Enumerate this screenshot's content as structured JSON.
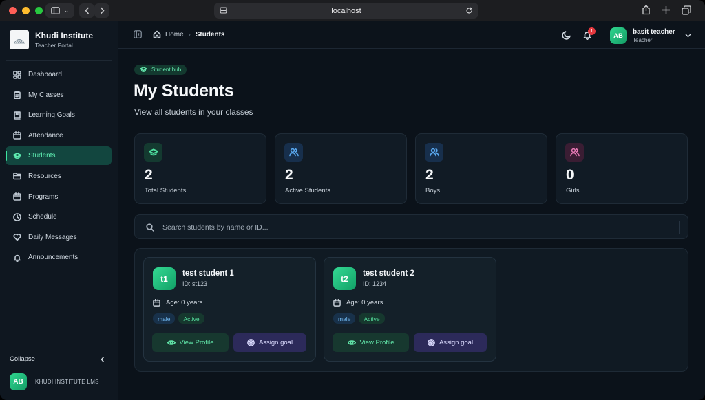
{
  "browser": {
    "url": "localhost",
    "traffic_colors": [
      "#ff5f57",
      "#febc2e",
      "#28c840"
    ]
  },
  "sidebar": {
    "brand_name": "Khudi Institute",
    "brand_sub": "Teacher Portal",
    "items": [
      {
        "label": "Dashboard",
        "icon": "dashboard-icon"
      },
      {
        "label": "My Classes",
        "icon": "clipboard-icon"
      },
      {
        "label": "Learning Goals",
        "icon": "book-icon"
      },
      {
        "label": "Attendance",
        "icon": "calendar-icon"
      },
      {
        "label": "Students",
        "icon": "graduation-cap-icon",
        "active": true
      },
      {
        "label": "Resources",
        "icon": "folder-icon"
      },
      {
        "label": "Programs",
        "icon": "calendar-icon"
      },
      {
        "label": "Schedule",
        "icon": "clock-icon"
      },
      {
        "label": "Daily Messages",
        "icon": "heart-icon"
      },
      {
        "label": "Announcements",
        "icon": "bell-icon"
      }
    ],
    "collapse_label": "Collapse",
    "footer_avatar": "AB",
    "footer_label": "KHUDI INSTITUTE LMS"
  },
  "topbar": {
    "breadcrumb_home": "Home",
    "breadcrumb_current": "Students",
    "notification_count": "1",
    "user_initials": "AB",
    "user_name": "basit teacher",
    "user_role": "Teacher"
  },
  "page": {
    "pill": "Student hub",
    "title": "My Students",
    "subtitle": "View all students in your classes",
    "accent": "#3ee29f"
  },
  "stats": [
    {
      "value": "2",
      "label": "Total Students",
      "icon": "graduation-cap-icon",
      "color": "#4fe0a0",
      "bg": "#143a30"
    },
    {
      "value": "2",
      "label": "Active Students",
      "icon": "users-icon",
      "color": "#5aa9f0",
      "bg": "#172f4c"
    },
    {
      "value": "2",
      "label": "Boys",
      "icon": "users-icon",
      "color": "#5aa9f0",
      "bg": "#172f4c"
    },
    {
      "value": "0",
      "label": "Girls",
      "icon": "users-icon",
      "color": "#e879b5",
      "bg": "#3a1d33"
    }
  ],
  "search": {
    "placeholder": "Search students by name or ID..."
  },
  "students": [
    {
      "initials": "t1",
      "name": "test student 1",
      "id": "ID: st123",
      "age": "Age: 0 years",
      "gender": "male",
      "status": "Active",
      "view_label": "View Profile",
      "goal_label": "Assign goal"
    },
    {
      "initials": "t2",
      "name": "test student 2",
      "id": "ID: 1234",
      "age": "Age: 0 years",
      "gender": "male",
      "status": "Active",
      "view_label": "View Profile",
      "goal_label": "Assign goal"
    }
  ]
}
